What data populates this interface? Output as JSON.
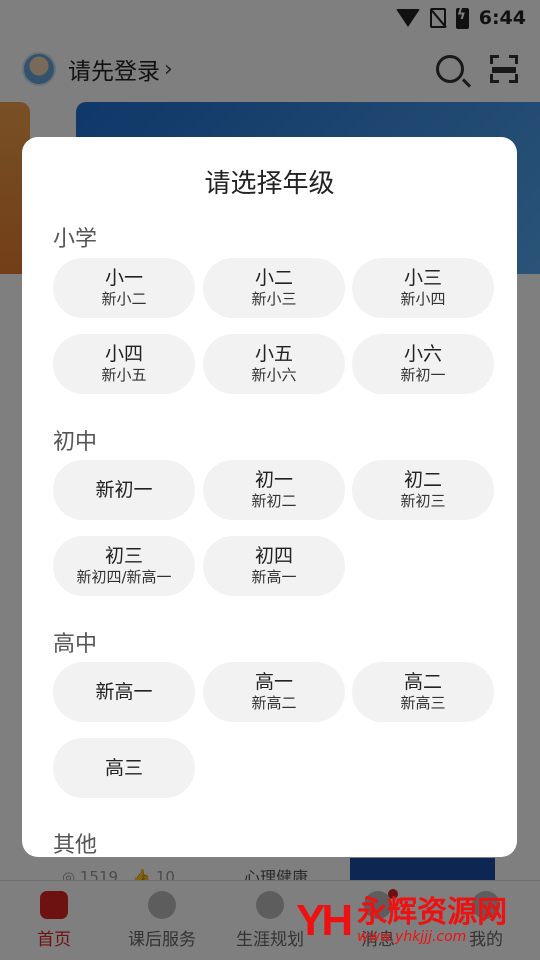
{
  "status_bar": {
    "time": "6:44"
  },
  "header": {
    "login_label": "请先登录",
    "chevron": "›"
  },
  "feed": {
    "views": "1519",
    "likes": "10",
    "tag": "心理健康"
  },
  "tab_bar": {
    "tabs": [
      {
        "label": "首页",
        "icon": "play-icon",
        "active": true
      },
      {
        "label": "课后服务",
        "icon": "heart-icon",
        "active": false
      },
      {
        "label": "生涯规划",
        "icon": "compass-icon",
        "active": false
      },
      {
        "label": "消息",
        "icon": "bell-icon",
        "active": false
      },
      {
        "label": "我的",
        "icon": "user-icon",
        "active": false
      }
    ]
  },
  "watermark": {
    "logo": "YH",
    "name": "永辉资源网",
    "url": "www.yhkjjj.com"
  },
  "modal": {
    "title": "请选择年级",
    "sections": [
      {
        "label": "小学",
        "options": [
          {
            "main": "小一",
            "sub": "新小二"
          },
          {
            "main": "小二",
            "sub": "新小三"
          },
          {
            "main": "小三",
            "sub": "新小四"
          },
          {
            "main": "小四",
            "sub": "新小五"
          },
          {
            "main": "小五",
            "sub": "新小六"
          },
          {
            "main": "小六",
            "sub": "新初一"
          }
        ]
      },
      {
        "label": "初中",
        "options": [
          {
            "main": "新初一",
            "sub": ""
          },
          {
            "main": "初一",
            "sub": "新初二"
          },
          {
            "main": "初二",
            "sub": "新初三"
          },
          {
            "main": "初三",
            "sub": "新初四/新高一"
          },
          {
            "main": "初四",
            "sub": "新高一"
          }
        ]
      },
      {
        "label": "高中",
        "options": [
          {
            "main": "新高一",
            "sub": ""
          },
          {
            "main": "高一",
            "sub": "新高二"
          },
          {
            "main": "高二",
            "sub": "新高三"
          },
          {
            "main": "高三",
            "sub": ""
          }
        ]
      },
      {
        "label": "其他",
        "options": []
      }
    ]
  },
  "colors": {
    "accent": "#dd2222",
    "overlay": "rgba(0,0,0,0.5)",
    "pill_bg": "#f2f2f2"
  }
}
